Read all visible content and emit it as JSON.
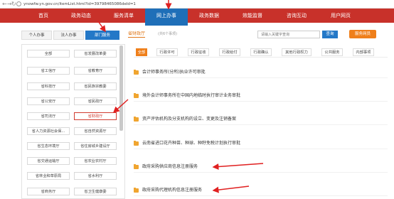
{
  "browser": {
    "back": "←",
    "forward": "→",
    "refresh": "↻",
    "url": "ynowfw.yn.gov.cn/itemList.html?id=39798465086deId=1"
  },
  "topnav": [
    {
      "label": "首页"
    },
    {
      "label": "政务动态"
    },
    {
      "label": "服务清单"
    },
    {
      "label": "网上办事"
    },
    {
      "label": "政务数据"
    },
    {
      "label": "效能监督"
    },
    {
      "label": "咨询互动"
    },
    {
      "label": "用户网页"
    }
  ],
  "left_tabs": [
    {
      "label": "个人办事"
    },
    {
      "label": "法人办事"
    },
    {
      "label": "部门服务"
    }
  ],
  "departments": [
    {
      "label": "全部"
    },
    {
      "label": "省发展改革委"
    },
    {
      "label": "省工信厅"
    },
    {
      "label": "省教育厅"
    },
    {
      "label": "省科技厅"
    },
    {
      "label": "省民族宗教委"
    },
    {
      "label": "省公安厅"
    },
    {
      "label": "省民政厅"
    },
    {
      "label": "省司法厅"
    },
    {
      "label": "省财政厅"
    },
    {
      "label": "省人力资源社会保..."
    },
    {
      "label": "省自然资源厅"
    },
    {
      "label": "省生态环境厅"
    },
    {
      "label": "省住房城乡建设厅"
    },
    {
      "label": "省交通运输厅"
    },
    {
      "label": "省农业农村厅"
    },
    {
      "label": "省林业和草原局"
    },
    {
      "label": "省水利厅"
    },
    {
      "label": "省商务厅"
    },
    {
      "label": "省卫生健康委"
    }
  ],
  "right_header": {
    "title": "省财政厅",
    "count": "(共6个事项)",
    "search_placeholder": "请输入关键字查询",
    "search_button": "查询",
    "other_button": "服务网员"
  },
  "categories": [
    {
      "label": "全部"
    },
    {
      "label": "行政许可"
    },
    {
      "label": "行政征收"
    },
    {
      "label": "行政给付"
    },
    {
      "label": "行政确认"
    },
    {
      "label": "其他行政权力"
    },
    {
      "label": "公共服务"
    },
    {
      "label": "内部事项"
    }
  ],
  "services": [
    {
      "label": "会计师事务所(分所)执业许可审批"
    },
    {
      "label": "境外会计师事务所在中国内地临时执行审计业务审批"
    },
    {
      "label": "资产评估机构及分支机构的设立、变更及注销备案"
    },
    {
      "label": "云南省进口花卉种苗、种球、种籽免税计划执行审批"
    },
    {
      "label": "政府采购供应商信息注册服务"
    },
    {
      "label": "政府采购代理机构信息注册服务"
    }
  ]
}
